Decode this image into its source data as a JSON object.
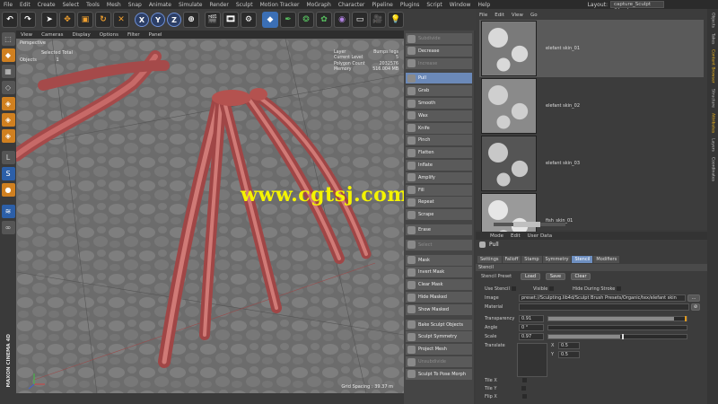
{
  "menubar": {
    "items": [
      "File",
      "Edit",
      "Create",
      "Select",
      "Tools",
      "Mesh",
      "Snap",
      "Animate",
      "Simulate",
      "Render",
      "Sculpt",
      "Motion Tracker",
      "MoGraph",
      "Character",
      "Pipeline",
      "Plugins",
      "Script",
      "Window",
      "Help"
    ],
    "layout_label": "Layout:",
    "layout_value": "capture_Sculpt (User)"
  },
  "toolbar": {
    "axis_x": "X",
    "axis_y": "Y",
    "axis_z": "Z"
  },
  "viewport": {
    "menu": [
      "View",
      "Cameras",
      "Display",
      "Options",
      "Filter",
      "Panel"
    ],
    "label": "Perspective",
    "selected_total": "Selected Total",
    "objects_label": "Objects",
    "objects_value": "1",
    "hud": {
      "layer_label": "Layer",
      "layer_value": "Bumps legs",
      "level_label": "Current Level",
      "level_value": "5",
      "poly_label": "Polygon Count",
      "poly_value": "2032576",
      "mem_label": "Memory",
      "mem_value": "516.004 MB"
    },
    "grid_spacing": "Grid Spacing : 39.37 m",
    "watermark": "www.cgtsj.com",
    "logo": "MAXON CINEMA 4D"
  },
  "brushes": {
    "items": [
      {
        "label": "Subdivide",
        "state": "disabled"
      },
      {
        "label": "Decrease",
        "state": "normal"
      },
      {
        "label": "Increase",
        "state": "disabled"
      },
      {
        "label": "Pull",
        "state": "active"
      },
      {
        "label": "Grab",
        "state": "normal"
      },
      {
        "label": "Smooth",
        "state": "normal"
      },
      {
        "label": "Wax",
        "state": "normal"
      },
      {
        "label": "Knife",
        "state": "normal"
      },
      {
        "label": "Pinch",
        "state": "normal"
      },
      {
        "label": "Flatten",
        "state": "normal"
      },
      {
        "label": "Inflate",
        "state": "normal"
      },
      {
        "label": "Amplify",
        "state": "normal"
      },
      {
        "label": "Fill",
        "state": "normal"
      },
      {
        "label": "Repeat",
        "state": "normal"
      },
      {
        "label": "Scrape",
        "state": "normal"
      },
      {
        "label": "Erase",
        "state": "normal"
      },
      {
        "label": "Select",
        "state": "disabled"
      },
      {
        "label": "Mask",
        "state": "normal"
      },
      {
        "label": "Invert Mask",
        "state": "normal"
      },
      {
        "label": "Clear Mask",
        "state": "normal"
      },
      {
        "label": "Hide Masked",
        "state": "normal"
      },
      {
        "label": "Show Masked",
        "state": "normal"
      },
      {
        "label": "Bake Sculpt Objects",
        "state": "normal"
      },
      {
        "label": "Sculpt Symmetry",
        "state": "normal"
      },
      {
        "label": "Project Mesh",
        "state": "normal"
      },
      {
        "label": "Unsubdivide",
        "state": "disabled"
      },
      {
        "label": "Sculpt To Pose Morph",
        "state": "normal"
      }
    ]
  },
  "content_browser": {
    "menu": [
      "File",
      "Edit",
      "View",
      "Go"
    ],
    "items": [
      {
        "name": "elefant skin_01",
        "selected": true
      },
      {
        "name": "elefant skin_02",
        "selected": false
      },
      {
        "name": "elefant skin_03",
        "selected": false
      },
      {
        "name": "fish_skin_01",
        "selected": false
      }
    ]
  },
  "right_strip": [
    "Objects",
    "Takes",
    "Content Browser",
    "Structure",
    "Attributes",
    "Layers",
    "Coordinates"
  ],
  "attributes": {
    "menu": [
      "Mode",
      "Edit",
      "User Data"
    ],
    "title": "Pull",
    "tabs": [
      "Settings",
      "Falloff",
      "Stamp",
      "Symmetry",
      "Stencil",
      "Modifiers"
    ],
    "active_tab": "Stencil",
    "section": "Stencil",
    "preset_label": "Stencil Preset",
    "load": "Load",
    "save": "Save",
    "clear": "Clear",
    "use_stencil": "Use Stencil",
    "visible": "Visible",
    "hide_during_stroke": "Hide During Stroke",
    "image_label": "Image",
    "image_value": "preset://Sculpting.lib4d/Sculpt Brush Presets/Organic/tex/elefant skin",
    "material_label": "Material",
    "transparency_label": "Transparency",
    "transparency_value": "0.91",
    "angle_label": "Angle",
    "angle_value": "0 °",
    "scale_label": "Scale",
    "scale_value": "0.97",
    "translate_label": "Translate",
    "tx_label": "X",
    "tx_value": "0.5",
    "ty_label": "Y",
    "ty_value": "0.5",
    "tile_x": "Tile X",
    "tile_y": "Tile Y",
    "flip_x": "Flip X"
  },
  "colors": {
    "accent": "#6b89b8",
    "highlight": "#e09a20",
    "watermark": "#f4f400"
  }
}
